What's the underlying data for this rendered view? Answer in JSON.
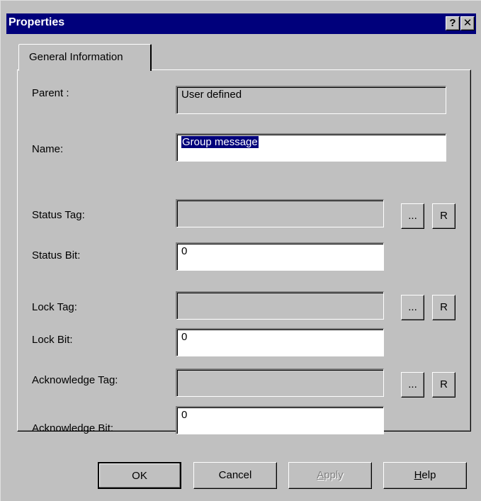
{
  "window": {
    "title": "Properties",
    "help_button": "?",
    "close_button": "✕"
  },
  "tab": {
    "label": "General Information"
  },
  "fields": {
    "parent": {
      "label": "Parent :",
      "value": "User defined"
    },
    "name": {
      "label": "Name:",
      "value": "Group message"
    },
    "status_tag": {
      "label": "Status Tag:",
      "value": ""
    },
    "status_bit": {
      "label": "Status Bit:",
      "value": "0"
    },
    "lock_tag": {
      "label": "Lock Tag:",
      "value": ""
    },
    "lock_bit": {
      "label": "Lock Bit:",
      "value": "0"
    },
    "ack_tag": {
      "label": "Acknowledge Tag:",
      "value": ""
    },
    "ack_bit": {
      "label": "Acknowledge Bit:",
      "value": "0"
    }
  },
  "tag_buttons": {
    "browse": "...",
    "reset": "R"
  },
  "buttons": {
    "ok": "OK",
    "cancel": "Cancel",
    "apply_prefix": "",
    "apply_mnemonic": "A",
    "apply_rest": "pply",
    "help_mnemonic": "H",
    "help_rest": "elp"
  },
  "colors": {
    "face": "#c0c0c0",
    "titlebar": "#00007b",
    "selection": "#00007b"
  }
}
